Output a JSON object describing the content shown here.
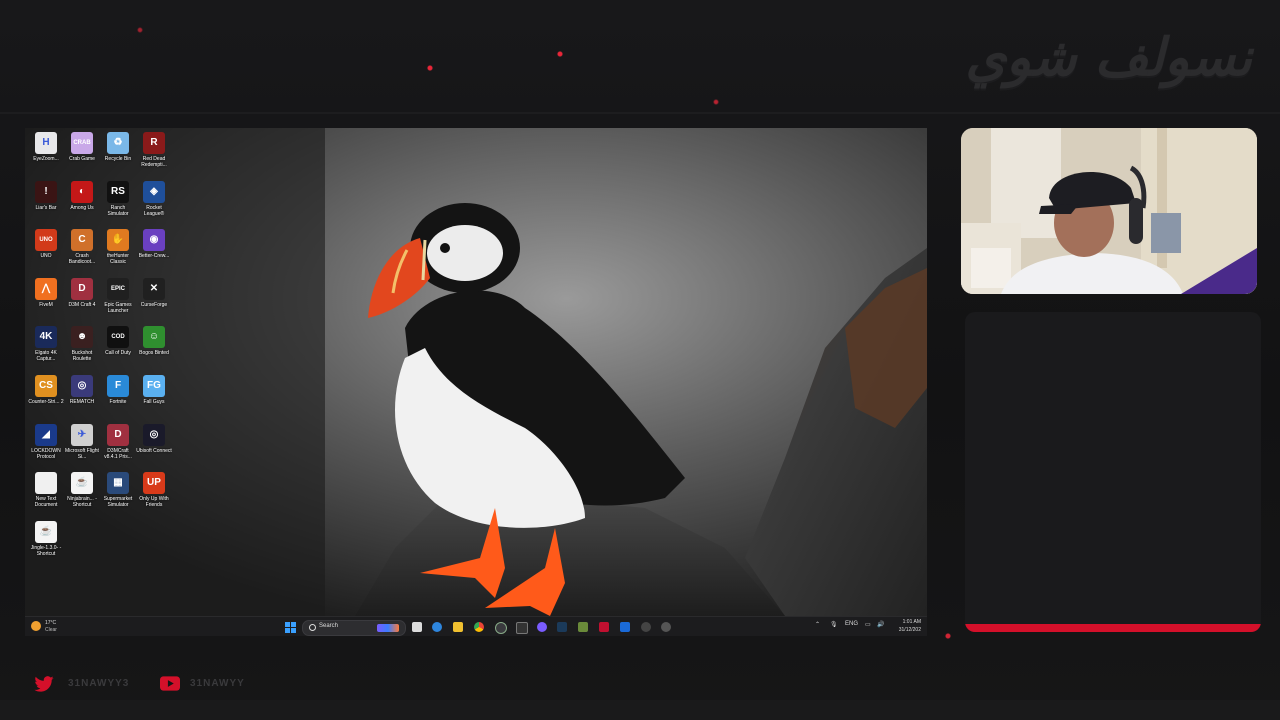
{
  "overlay": {
    "brand_title": "نسولف شوي",
    "socials": [
      {
        "platform": "twitter",
        "handle": "31NAWYY3"
      },
      {
        "platform": "youtube",
        "handle": "31NAWYY"
      }
    ],
    "accent_color": "#d4102a"
  },
  "desktop": {
    "icons": [
      {
        "label": "EyeZoom...",
        "icon": "eyezoom-icon",
        "color": "#e8e8ea",
        "glyph": "H"
      },
      {
        "label": "Crab Game",
        "icon": "crab-game-icon",
        "color": "#c9a8e8",
        "glyph": "CRAB"
      },
      {
        "label": "Recycle Bin",
        "icon": "recycle-bin-icon",
        "color": "#7ab8e8",
        "glyph": "♻"
      },
      {
        "label": "Red Dead Redempti...",
        "icon": "red-dead-icon",
        "color": "#8a1a1a",
        "glyph": "R"
      },
      {
        "label": "Liar's Bar",
        "icon": "liars-bar-icon",
        "color": "#3a1414",
        "glyph": "!"
      },
      {
        "label": "Among Us",
        "icon": "among-us-icon",
        "color": "#c41818",
        "glyph": "◐"
      },
      {
        "label": "Ranch Simulator",
        "icon": "ranch-simulator-icon",
        "color": "#111111",
        "glyph": "RS"
      },
      {
        "label": "Rocket League®",
        "icon": "rocket-league-icon",
        "color": "#1f4f9a",
        "glyph": "◈"
      },
      {
        "label": "UNO",
        "icon": "uno-icon",
        "color": "#d23a1a",
        "glyph": "UNO"
      },
      {
        "label": "Crash Bandicoot...",
        "icon": "crash-bandicoot-icon",
        "color": "#d0702a",
        "glyph": "C"
      },
      {
        "label": "theHunter Classic",
        "icon": "thehunter-icon",
        "color": "#e07a20",
        "glyph": "✋"
      },
      {
        "label": "Better-Crew...",
        "icon": "better-crew-icon",
        "color": "#6a40c0",
        "glyph": "◉"
      },
      {
        "label": "FiveM",
        "icon": "fivem-icon",
        "color": "#f07020",
        "glyph": "⋀"
      },
      {
        "label": "D3M Craft 4",
        "icon": "d3m-craft-icon",
        "color": "#a03040",
        "glyph": "D"
      },
      {
        "label": "Epic Games Launcher",
        "icon": "epic-games-icon",
        "color": "#202020",
        "glyph": "EPIC"
      },
      {
        "label": "CurseForge",
        "icon": "curseforge-icon",
        "color": "#202020",
        "glyph": "✕"
      },
      {
        "label": "Elgato 4K Captur...",
        "icon": "elgato-icon",
        "color": "#1a2a5a",
        "glyph": "4K"
      },
      {
        "label": "Buckshot Roulette",
        "icon": "buckshot-roulette-icon",
        "color": "#3a2020",
        "glyph": "☻"
      },
      {
        "label": "Call of Duty",
        "icon": "call-of-duty-icon",
        "color": "#101010",
        "glyph": "COD"
      },
      {
        "label": "Bogos Binted",
        "icon": "bogos-binted-icon",
        "color": "#2f8f2f",
        "glyph": "☺"
      },
      {
        "label": "Counter-Stri... 2",
        "icon": "counter-strike-icon",
        "color": "#e09020",
        "glyph": "CS"
      },
      {
        "label": "REMATCH",
        "icon": "rematch-icon",
        "color": "#3a3a7a",
        "glyph": "◎"
      },
      {
        "label": "Fortnite",
        "icon": "fortnite-icon",
        "color": "#2a8ad8",
        "glyph": "F"
      },
      {
        "label": "Fall Guys",
        "icon": "fall-guys-icon",
        "color": "#5ab0f0",
        "glyph": "FG"
      },
      {
        "label": "LOCKDOWN Protocol",
        "icon": "lockdown-protocol-icon",
        "color": "#1a3a8a",
        "glyph": "◢"
      },
      {
        "label": "Microsoft Flight Si...",
        "icon": "flight-simulator-icon",
        "color": "#d0d0d0",
        "glyph": "✈"
      },
      {
        "label": "D3MCraft v8.4.1 Pris...",
        "icon": "d3mcraft-icon",
        "color": "#a03040",
        "glyph": "D"
      },
      {
        "label": "Ubisoft Connect",
        "icon": "ubisoft-connect-icon",
        "color": "#1a1a2a",
        "glyph": "◎"
      },
      {
        "label": "New Text Document",
        "icon": "text-document-icon",
        "color": "#f0f0f0",
        "glyph": ""
      },
      {
        "label": "Ninjabrain... - Shortcut",
        "icon": "java-shortcut-icon",
        "color": "#f4f4f4",
        "glyph": "☕"
      },
      {
        "label": "Supermarket Simulator",
        "icon": "supermarket-simulator-icon",
        "color": "#2a4a7a",
        "glyph": "▦"
      },
      {
        "label": "Only Up With Friends",
        "icon": "only-up-icon",
        "color": "#d83a1a",
        "glyph": "UP"
      },
      {
        "label": "Jingle-1.3.0- - Shortcut",
        "icon": "java-shortcut-icon",
        "color": "#f4f4f4",
        "glyph": "☕"
      }
    ],
    "taskbar": {
      "weather_temp": "17°C",
      "weather_condition": "Clear",
      "search_placeholder": "Search",
      "language": "ENG",
      "time": "1:01 AM",
      "date": "31/12/202"
    }
  }
}
